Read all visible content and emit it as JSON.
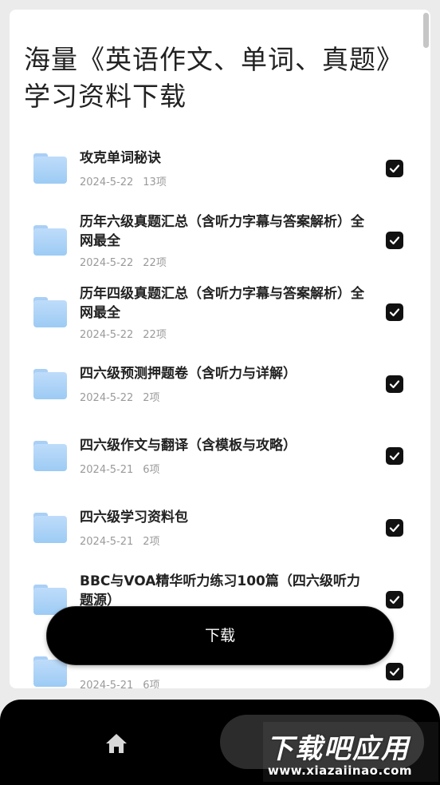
{
  "page": {
    "title": "海量《英语作文、单词、真题》学习资料下载"
  },
  "items": [
    {
      "name": "攻克单词秘诀",
      "date": "2024-5-22",
      "count": "13项",
      "checked": true
    },
    {
      "name": "历年六级真题汇总（含听力字幕与答案解析）全网最全",
      "date": "2024-5-22",
      "count": "22项",
      "checked": true
    },
    {
      "name": "历年四级真题汇总（含听力字幕与答案解析）全网最全",
      "date": "2024-5-22",
      "count": "22项",
      "checked": true
    },
    {
      "name": "四六级预测押题卷（含听力与详解）",
      "date": "2024-5-22",
      "count": "2项",
      "checked": true
    },
    {
      "name": "四六级作文与翻译（含模板与攻略）",
      "date": "2024-5-21",
      "count": "6项",
      "checked": true
    },
    {
      "name": "四六级学习资料包",
      "date": "2024-5-21",
      "count": "2项",
      "checked": true
    },
    {
      "name": "BBC与VOA精华听力练习100篇（四六级听力题源）",
      "date": "",
      "count": "",
      "checked": true
    },
    {
      "name": "",
      "date": "2024-5-21",
      "count": "6项",
      "checked": true
    }
  ],
  "download_button": {
    "label": "下载"
  },
  "nav": {
    "home_icon": "home-icon"
  },
  "watermark": {
    "main": "下载吧应用",
    "sub": "www.xiazaiinao.com"
  }
}
